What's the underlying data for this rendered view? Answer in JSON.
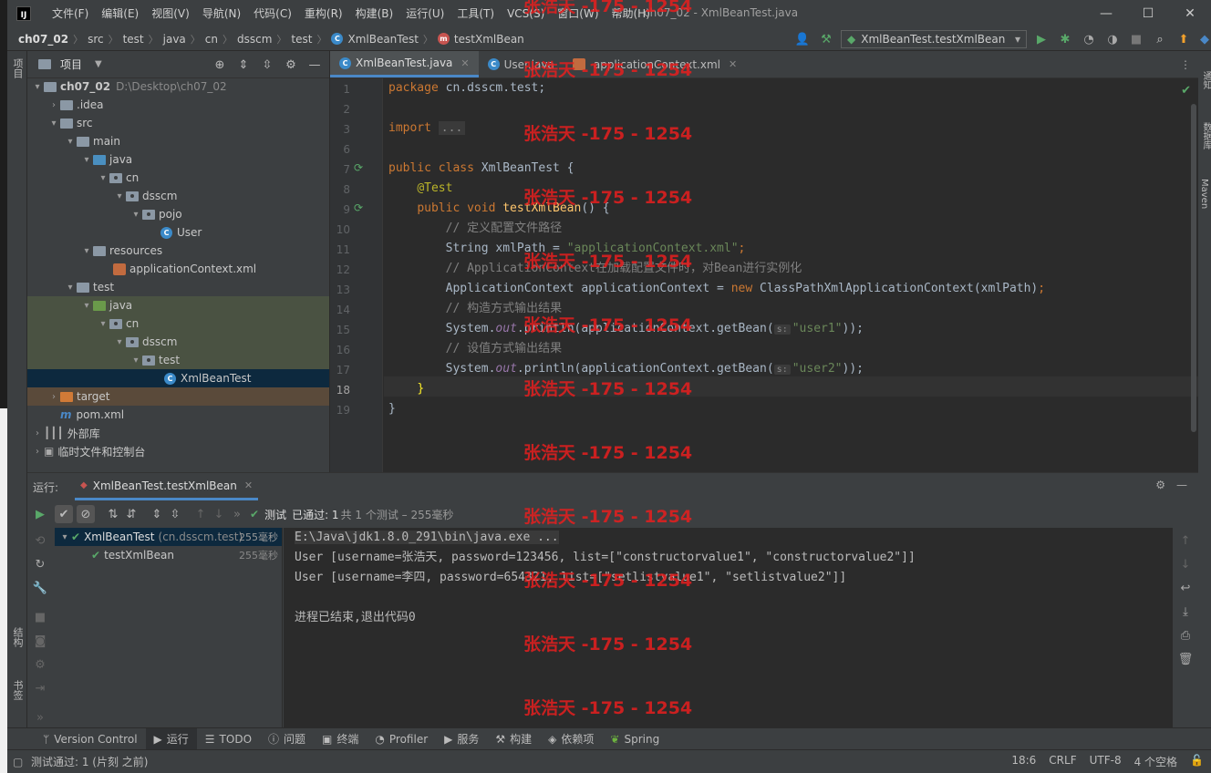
{
  "titlebar": {
    "menu": [
      "文件(F)",
      "编辑(E)",
      "视图(V)",
      "导航(N)",
      "代码(C)",
      "重构(R)",
      "构建(B)",
      "运行(U)",
      "工具(T)",
      "VCS(S)",
      "窗口(W)",
      "帮助(H)"
    ],
    "window_title": "ch07_02 - XmlBeanTest.java",
    "minimize": "—",
    "maximize": "☐",
    "close": "✕"
  },
  "navbar": {
    "crumbs": [
      "ch07_02",
      "src",
      "test",
      "java",
      "cn",
      "dsscm",
      "test",
      "XmlBeanTest",
      "testXmlBean"
    ],
    "run_config": "XmlBeanTest.testXmlBean"
  },
  "left_strip": {
    "project_tab": "项目",
    "structure_tab": "结构",
    "bookmarks_tab": "书签"
  },
  "right_strip": {
    "notifications_tab": "通知",
    "database_tab": "数据库",
    "maven_tab": "Maven"
  },
  "project_panel": {
    "title": "项目",
    "tree": [
      {
        "label": "ch07_02",
        "extra": "D:\\Desktop\\ch07_02"
      },
      {
        "label": ".idea"
      },
      {
        "label": "src"
      },
      {
        "label": "main"
      },
      {
        "label": "java"
      },
      {
        "label": "cn"
      },
      {
        "label": "dsscm"
      },
      {
        "label": "pojo"
      },
      {
        "label": "User"
      },
      {
        "label": "resources"
      },
      {
        "label": "applicationContext.xml"
      },
      {
        "label": "test"
      },
      {
        "label": "java"
      },
      {
        "label": "cn"
      },
      {
        "label": "dsscm"
      },
      {
        "label": "test"
      },
      {
        "label": "XmlBeanTest"
      },
      {
        "label": "target"
      },
      {
        "label": "pom.xml"
      },
      {
        "label": "外部库"
      },
      {
        "label": "临时文件和控制台"
      }
    ]
  },
  "editor": {
    "tabs": [
      {
        "label": "XmlBeanTest.java",
        "active": true
      },
      {
        "label": "User.java",
        "active": false
      },
      {
        "label": "applicationContext.xml",
        "active": false
      }
    ],
    "line_numbers": [
      "1",
      "2",
      "3",
      "6",
      "7",
      "8",
      "9",
      "10",
      "11",
      "12",
      "13",
      "14",
      "15",
      "16",
      "17",
      "18",
      "19"
    ],
    "code": {
      "l1_kw": "package",
      "l1_rest": " cn.dsscm.test;",
      "l3_kw": "import",
      "l3_fold": "...",
      "l7_kw": "public class",
      "l7_rest": " XmlBeanTest {",
      "l8_an": "@Test",
      "l9_kw": "public void",
      "l9_fn": "testXmlBean",
      "l9_rest": "() {",
      "l10_cm": "// 定义配置文件路径",
      "l11_a": "String xmlPath = ",
      "l11_str": "\"applicationContext.xml\"",
      "l11_end": ";",
      "l12_cm": "// ApplicationContext在加载配置文件时，对Bean进行实例化",
      "l13_a": "ApplicationContext applicationContext = ",
      "l13_kw": "new",
      "l13_b": " ClassPathXmlApplicationContext(xmlPath)",
      "l13_end": ";",
      "l14_cm": "// 构造方式输出结果",
      "l15_a": "System.",
      "l15_out": "out",
      "l15_b": ".println(applicationContext.getBean(",
      "l15_hint": "s:",
      "l15_str": "\"user1\"",
      "l15_end": "));",
      "l16_cm": "// 设值方式输出结果",
      "l17_a": "System.",
      "l17_out": "out",
      "l17_b": ".println(applicationContext.getBean(",
      "l17_hint": "s:",
      "l17_str": "\"user2\"",
      "l17_end": "));",
      "l18": "}",
      "l19": "}"
    }
  },
  "run_panel": {
    "label": "运行:",
    "tab": "XmlBeanTest.testXmlBean",
    "status_prefix": "测试",
    "status_passed": "已通过: 1",
    "status_detail": "共 1 个测试 – 255毫秒",
    "tests": [
      {
        "name": "XmlBeanTest",
        "pkg": "(cn.dsscm.test)",
        "time": "255毫秒"
      },
      {
        "name": "testXmlBean",
        "pkg": "",
        "time": "255毫秒"
      }
    ],
    "console": [
      "E:\\Java\\jdk1.8.0_291\\bin\\java.exe ...",
      "User [username=张浩天, password=123456, list=[\"constructorvalue1\", \"constructorvalue2\"]]",
      "User [username=李四, password=654321, list=[\"setlistvalue1\", \"setlistvalue2\"]]",
      "",
      "进程已结束,退出代码0"
    ]
  },
  "bottom_tools": [
    "Version Control",
    "运行",
    "TODO",
    "问题",
    "终端",
    "Profiler",
    "服务",
    "构建",
    "依赖项",
    "Spring"
  ],
  "statusbar": {
    "message": "测试通过: 1 (片刻 之前)",
    "position": "18:6",
    "line_sep": "CRLF",
    "encoding": "UTF-8",
    "indent": "4 个空格"
  },
  "watermark": "张浩天 -175 - 1254",
  "colors": {
    "accent": "#4a88c7",
    "pass": "#59a869",
    "watermark": "#e61e1e"
  }
}
